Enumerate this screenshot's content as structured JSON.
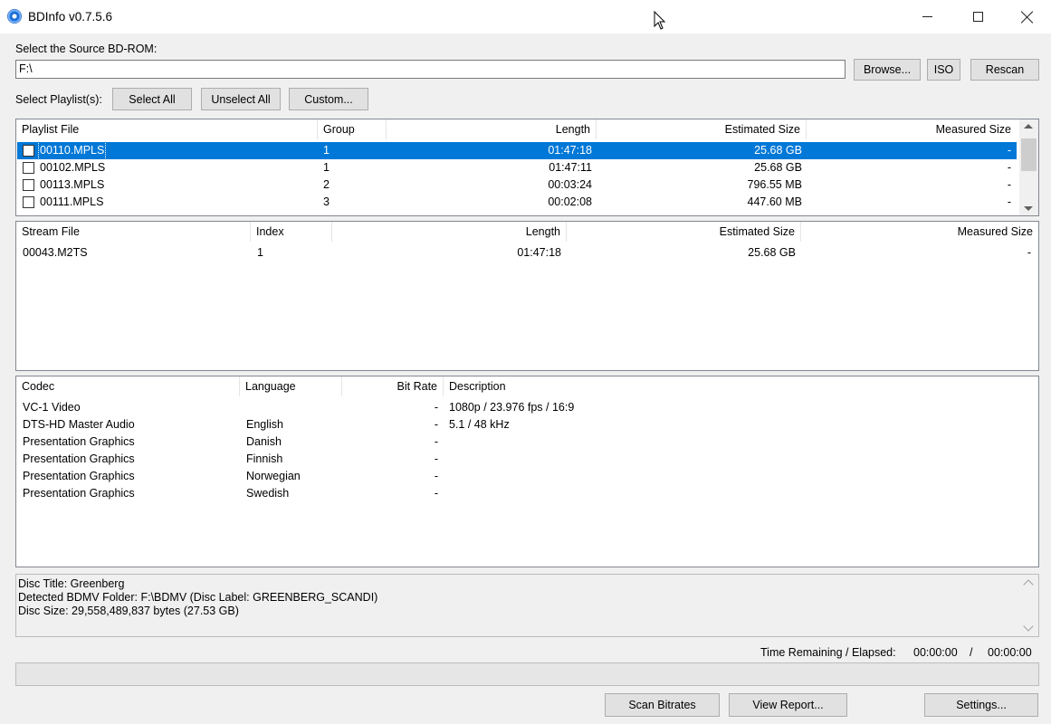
{
  "window": {
    "title": "BDInfo v0.7.5.6"
  },
  "source": {
    "label": "Select the Source BD-ROM:",
    "path": "F:\\",
    "browse_label": "Browse...",
    "iso_label": "ISO",
    "rescan_label": "Rescan"
  },
  "playlist_controls": {
    "label": "Select Playlist(s):",
    "select_all": "Select All",
    "unselect_all": "Unselect All",
    "custom": "Custom..."
  },
  "playlists": {
    "headers": [
      "Playlist File",
      "Group",
      "Length",
      "Estimated Size",
      "Measured Size"
    ],
    "rows": [
      {
        "file": "00110.MPLS",
        "group": "1",
        "length": "01:47:18",
        "estimated": "25.68 GB",
        "measured": "-",
        "selected": true,
        "checked": false
      },
      {
        "file": "00102.MPLS",
        "group": "1",
        "length": "01:47:11",
        "estimated": "25.68 GB",
        "measured": "-",
        "selected": false,
        "checked": false
      },
      {
        "file": "00113.MPLS",
        "group": "2",
        "length": "00:03:24",
        "estimated": "796.55 MB",
        "measured": "-",
        "selected": false,
        "checked": false
      },
      {
        "file": "00111.MPLS",
        "group": "3",
        "length": "00:02:08",
        "estimated": "447.60 MB",
        "measured": "-",
        "selected": false,
        "checked": false
      }
    ]
  },
  "streams": {
    "headers": [
      "Stream File",
      "Index",
      "Length",
      "Estimated Size",
      "Measured Size"
    ],
    "rows": [
      {
        "file": "00043.M2TS",
        "index": "1",
        "length": "01:47:18",
        "estimated": "25.68 GB",
        "measured": "-"
      }
    ]
  },
  "codecs": {
    "headers": [
      "Codec",
      "Language",
      "Bit Rate",
      "Description"
    ],
    "rows": [
      {
        "codec": "VC-1 Video",
        "language": "",
        "bitrate": "-",
        "description": "1080p / 23.976 fps / 16:9"
      },
      {
        "codec": "DTS-HD Master Audio",
        "language": "English",
        "bitrate": "-",
        "description": "5.1 / 48 kHz"
      },
      {
        "codec": "Presentation Graphics",
        "language": "Danish",
        "bitrate": "-",
        "description": ""
      },
      {
        "codec": "Presentation Graphics",
        "language": "Finnish",
        "bitrate": "-",
        "description": ""
      },
      {
        "codec": "Presentation Graphics",
        "language": "Norwegian",
        "bitrate": "-",
        "description": ""
      },
      {
        "codec": "Presentation Graphics",
        "language": "Swedish",
        "bitrate": "-",
        "description": ""
      }
    ]
  },
  "disc_info": {
    "lines": [
      "Disc Title: Greenberg",
      "Detected BDMV Folder: F:\\BDMV (Disc Label: GREENBERG_SCANDI)",
      "Disc Size: 29,558,489,837 bytes (27.53 GB)"
    ]
  },
  "timing": {
    "label": "Time Remaining / Elapsed:",
    "remaining": "00:00:00",
    "separator": "/",
    "elapsed": "00:00:00"
  },
  "progress": {
    "fraction": 0
  },
  "actions": {
    "scan_bitrates": "Scan Bitrates",
    "view_report": "View Report...",
    "settings": "Settings..."
  },
  "colors": {
    "selection": "#0078d7",
    "window_bg": "#f0f0f0"
  }
}
